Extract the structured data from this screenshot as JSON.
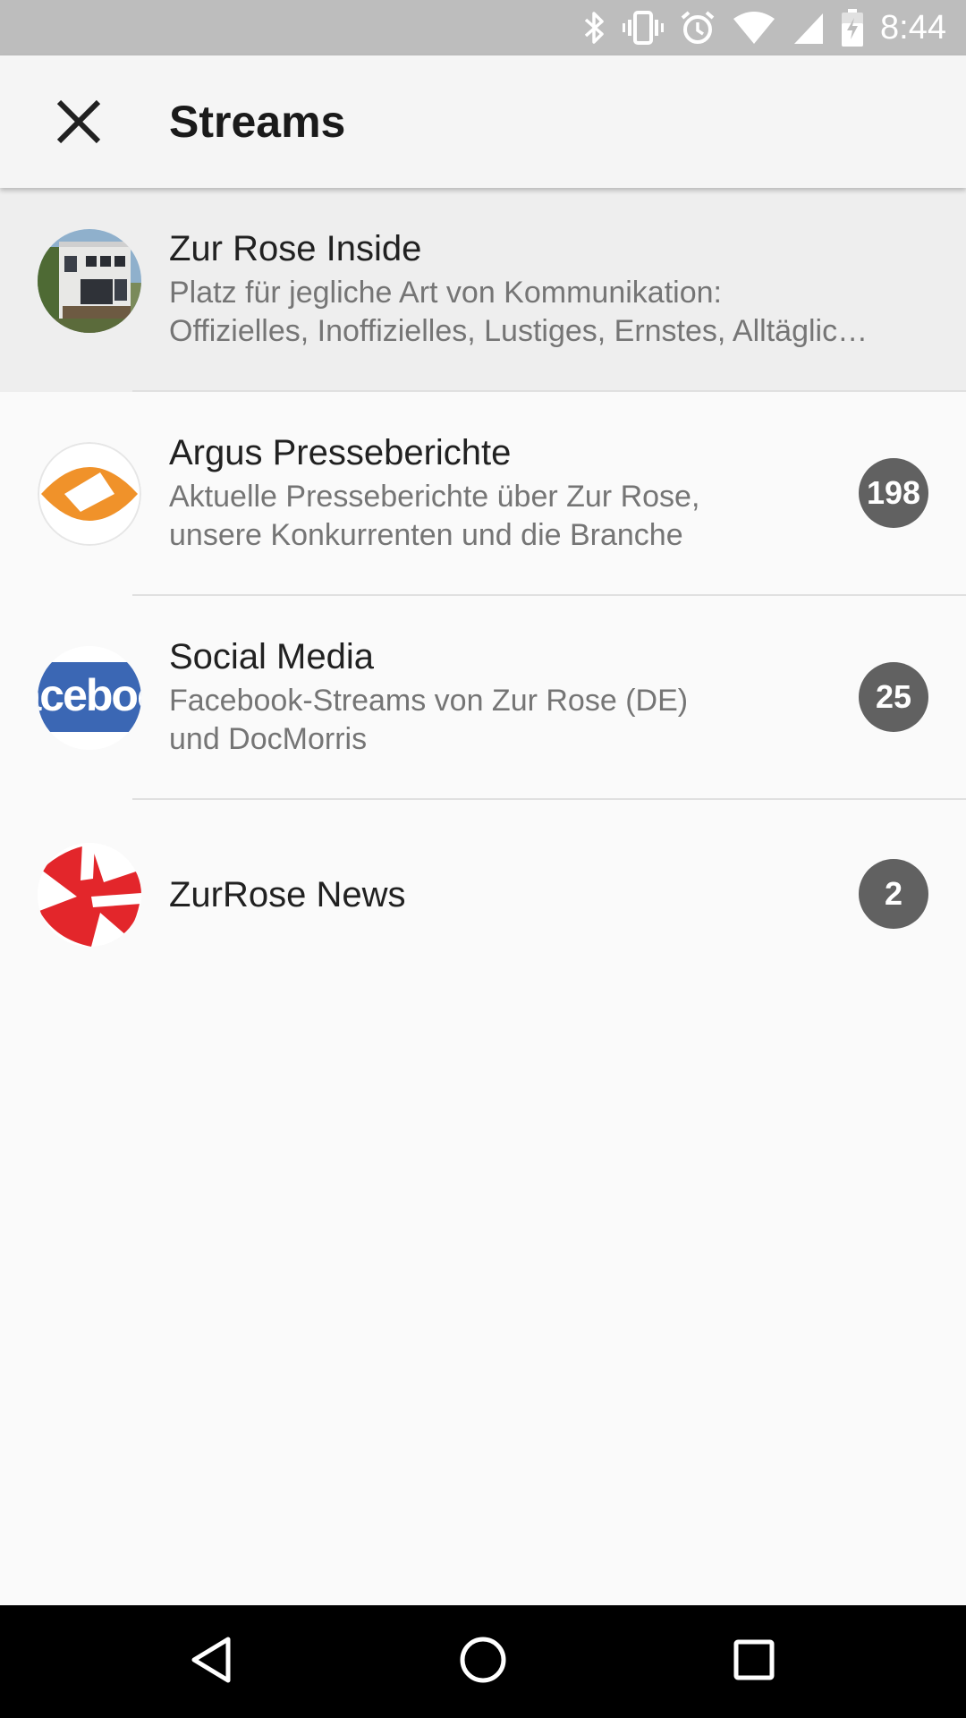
{
  "status_bar": {
    "time": "8:44",
    "icons": [
      "bluetooth-icon",
      "vibrate-icon",
      "alarm-icon",
      "wifi-icon",
      "signal-icon",
      "battery-charging-icon"
    ]
  },
  "app_bar": {
    "title": "Streams",
    "close_icon": "close-icon"
  },
  "streams": [
    {
      "title": "Zur Rose Inside",
      "description_lines": [
        "Platz für jegliche Art von Kommunikation:",
        "Offizielles, Inoffizielles, Lustiges, Ernstes, Alltäglic…"
      ],
      "badge": null,
      "avatar": "building-photo",
      "selected": true
    },
    {
      "title": "Argus Presseberichte",
      "description_lines": [
        "Aktuelle Presseberichte über Zur Rose,",
        "unsere Konkurrenten und die Branche"
      ],
      "badge": "198",
      "avatar": "argus-eye-logo",
      "selected": false
    },
    {
      "title": "Social Media",
      "description_lines": [
        "Facebook-Streams von Zur Rose (DE)",
        "und DocMorris"
      ],
      "badge": "25",
      "avatar": "facebook-logo",
      "avatar_text": "aceboo",
      "selected": false
    },
    {
      "title": "ZurRose News",
      "description_lines": [],
      "badge": "2",
      "avatar": "zurrose-logo",
      "selected": false
    }
  ],
  "colors": {
    "status_bar": "#bdbdbd",
    "app_bar": "#f5f5f5",
    "background": "#fafafa",
    "selected_row": "#eeeeee",
    "badge": "#616161",
    "argus_orange": "#f0922a",
    "facebook_blue": "#3b67b4",
    "zurrose_red": "#e3262b"
  },
  "nav_bar": {
    "buttons": [
      "back-icon",
      "home-icon",
      "recents-icon"
    ]
  }
}
